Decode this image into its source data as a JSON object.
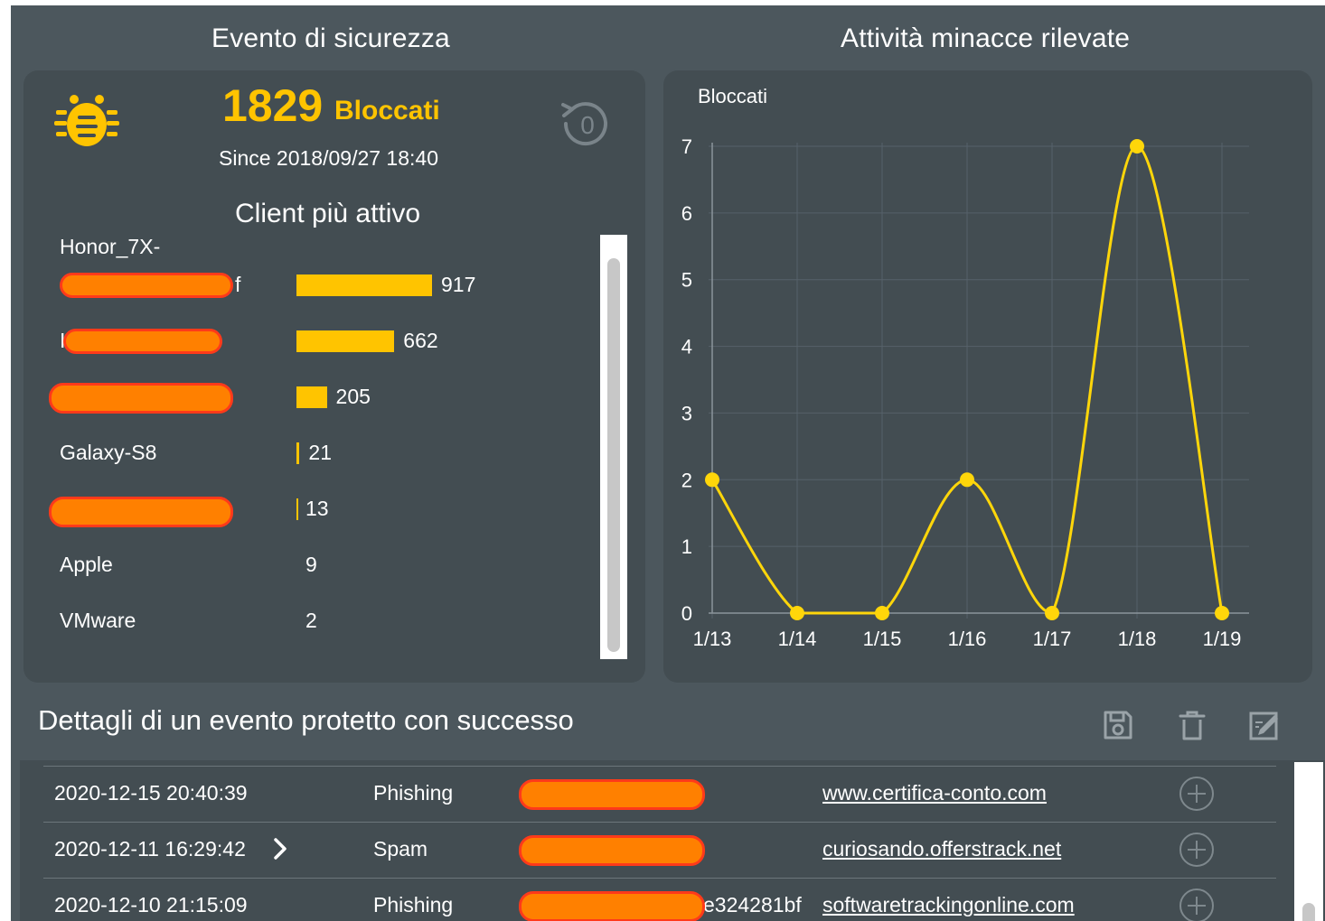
{
  "security_event": {
    "section_title": "Evento di sicurezza",
    "blocked_count": "1829",
    "blocked_label": "Bloccati",
    "since": "Since 2018/09/27 18:40",
    "reset_counter_icon": "reset-counter-icon",
    "reset_counter_glyph": "0",
    "icon": "bug-icon",
    "accent_color": "#ffc400"
  },
  "client_panel": {
    "title": "Client più attivo",
    "header_name": "Honor_7X-",
    "clients": [
      {
        "name_suffix": "f",
        "redacted": true,
        "count": "917",
        "value": 917
      },
      {
        "name_prefix": "I",
        "redacted": true,
        "count": "662",
        "value": 662
      },
      {
        "redacted": true,
        "count": "205",
        "value": 205
      },
      {
        "name": "Galaxy-S8",
        "redacted": false,
        "count": "21",
        "value": 21
      },
      {
        "redacted": true,
        "count": "13",
        "value": 13
      },
      {
        "name": "Apple",
        "redacted": false,
        "count": "9",
        "value": 9
      },
      {
        "name": "VMware",
        "redacted": false,
        "count": "2",
        "value": 2
      }
    ]
  },
  "threat_activity": {
    "section_title": "Attività minacce rilevate",
    "chart_label": "Bloccati"
  },
  "chart_data": {
    "type": "line",
    "title": "Attività minacce rilevate",
    "ylabel": "Bloccati",
    "xlabel": "",
    "categories": [
      "1/13",
      "1/14",
      "1/15",
      "1/16",
      "1/17",
      "1/18",
      "1/19"
    ],
    "series": [
      {
        "name": "Bloccati",
        "values": [
          2,
          0,
          0,
          2,
          0,
          7,
          0
        ]
      }
    ],
    "ylim": [
      0,
      7
    ],
    "yticks": [
      "0",
      "1",
      "2",
      "3",
      "4",
      "5",
      "6",
      "7"
    ],
    "grid": true,
    "line_color": "#ffd60a"
  },
  "details": {
    "title": "Dettagli di un evento protetto con successo",
    "toolbar_icons": [
      "save-icon",
      "trash-icon",
      "edit-icon"
    ],
    "rows": [
      {
        "datetime": "2020-12-15 20:40:39",
        "type": "Phishing",
        "source_redacted": true,
        "url": "www.certifica-conto.com",
        "has_chevron": false,
        "extra": ""
      },
      {
        "datetime": "2020-12-11 16:29:42",
        "type": "Spam",
        "source_redacted": true,
        "url": "curiosando.offerstrack.net",
        "has_chevron": true,
        "extra": ""
      },
      {
        "datetime": "2020-12-10 21:15:09",
        "type": "Phishing",
        "source_redacted": true,
        "url": "softwaretrackingonline.com",
        "has_chevron": false,
        "extra": "e324281bf"
      }
    ]
  },
  "colors": {
    "background": "#4c575d",
    "panel": "#434d52",
    "accent": "#ffc400",
    "redaction_fill": "#ff8000",
    "redaction_border": "#ff3a1a"
  }
}
